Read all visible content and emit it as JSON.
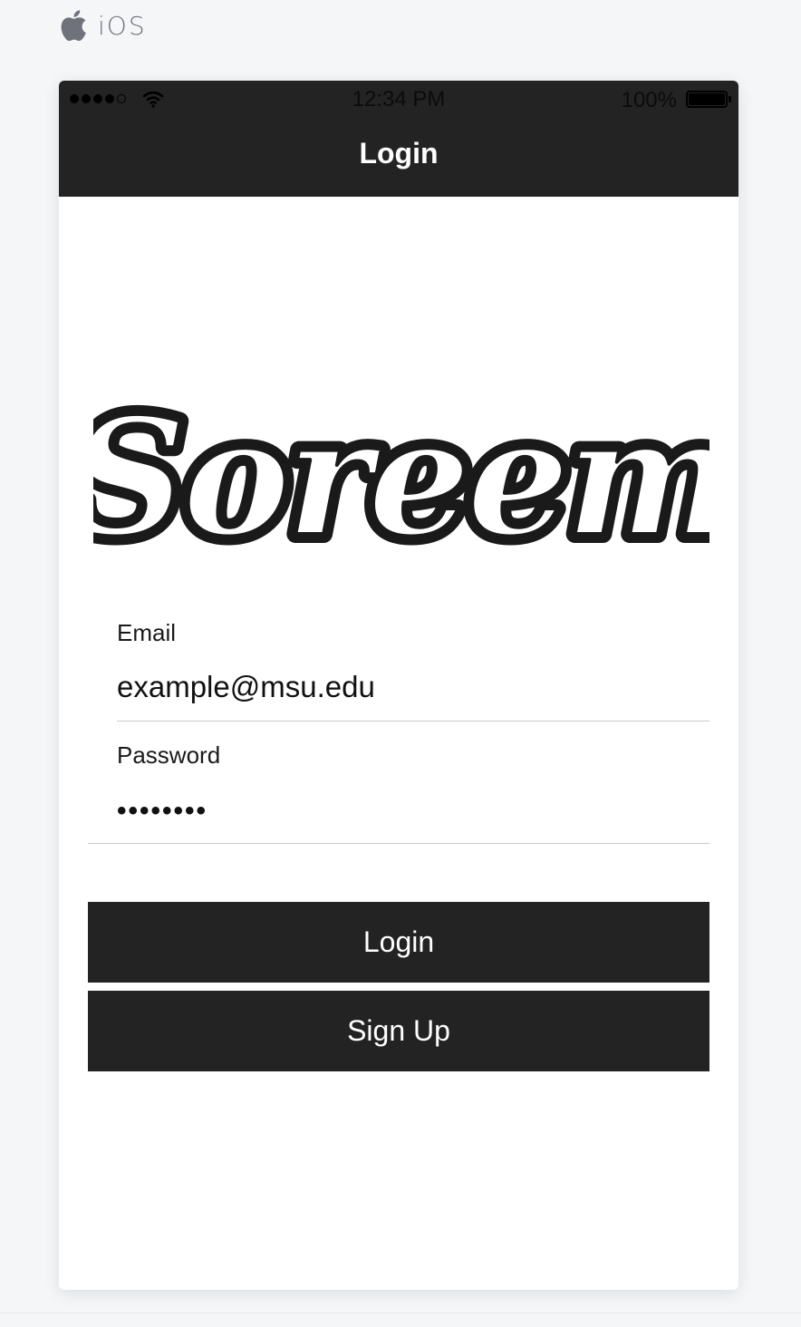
{
  "platform": {
    "icon": "apple-logo-icon",
    "label": "iOS"
  },
  "status_bar": {
    "signal_icon": "signal-dots-icon",
    "wifi_icon": "wifi-icon",
    "time": "12:34 PM",
    "battery_percent": "100%",
    "battery_icon": "battery-full-icon",
    "battery_level": 1.0
  },
  "nav": {
    "title": "Login"
  },
  "logo": {
    "text": "Soreem"
  },
  "form": {
    "email_label": "Email",
    "email_value": "example@msu.edu",
    "password_label": "Password",
    "password_value": "••••••••"
  },
  "buttons": {
    "login": "Login",
    "signup": "Sign Up"
  },
  "colors": {
    "bar_background": "#232323",
    "button_background": "#232323",
    "page_background": "#f5f6f8",
    "screen_background": "#ffffff"
  }
}
